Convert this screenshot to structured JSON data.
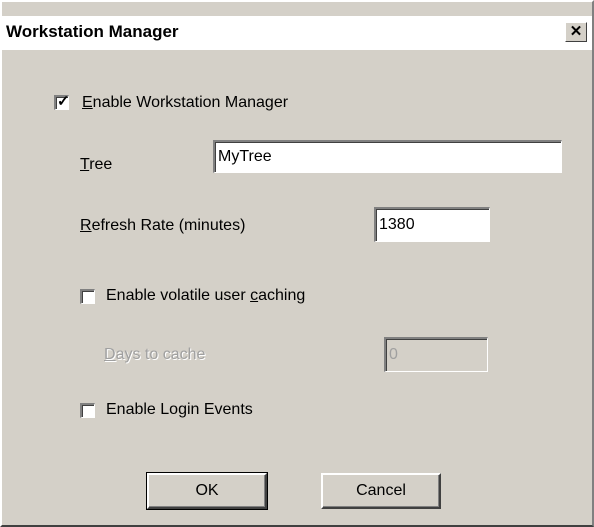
{
  "window": {
    "title": "Workstation Manager",
    "close_glyph": "✕"
  },
  "enable_manager": {
    "checked": true,
    "label_mnemonic": "E",
    "label_rest": "nable Workstation Manager"
  },
  "tree": {
    "label_mnemonic": "T",
    "label_rest": "ree",
    "value": "MyTree"
  },
  "refresh_rate": {
    "label_mnemonic": "R",
    "label_rest": "efresh Rate (minutes)",
    "value": "1380"
  },
  "volatile_caching": {
    "checked": false,
    "label_pre": "Enable volatile user ",
    "label_mnemonic": "c",
    "label_post": "aching"
  },
  "days_to_cache": {
    "label_mnemonic": "D",
    "label_rest": "ays to cache",
    "value": "0",
    "disabled": true
  },
  "login_events": {
    "checked": false,
    "label": "Enable Login Events"
  },
  "buttons": {
    "ok": "OK",
    "cancel": "Cancel"
  }
}
